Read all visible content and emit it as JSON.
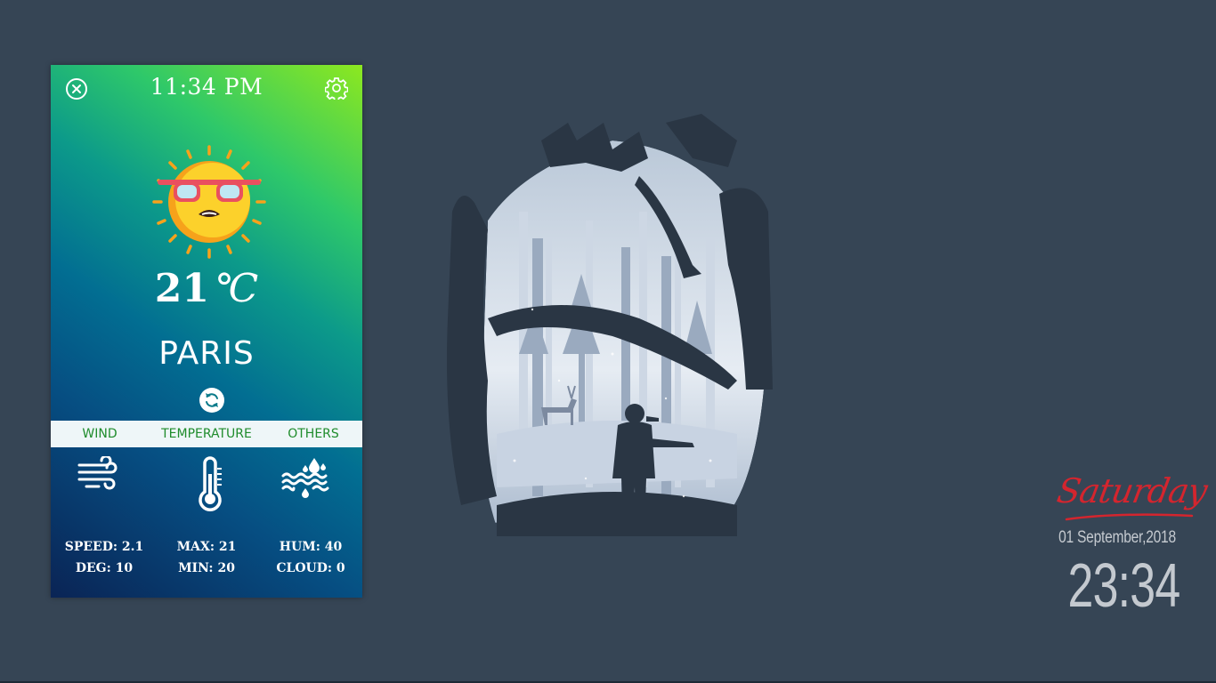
{
  "widget": {
    "time": "11:34 PM",
    "temperature": "21",
    "unit": "℃",
    "city": "PARIS",
    "tabs": [
      "WIND",
      "TEMPERATURE",
      "OTHERS"
    ],
    "stats": {
      "wind": {
        "line1": "SPEED: 2.1",
        "line2": "DEG: 10"
      },
      "temperature": {
        "line1": "MAX: 21",
        "line2": "MIN: 20"
      },
      "others": {
        "line1": "HUM: 40",
        "line2": "CLOUD: 0"
      }
    },
    "icons": [
      "close-icon",
      "settings-gear-icon",
      "sun-with-sunglasses-icon",
      "refresh-icon",
      "wind-icon",
      "thermometer-icon",
      "humidity-icon"
    ],
    "colors": {
      "gradient_top": "#8de81f",
      "gradient_bottom": "#0a2455",
      "tab_text": "#1f8c2c"
    }
  },
  "clock": {
    "day": "Saturday",
    "date": "01 September,2018",
    "time": "23:34",
    "colors": {
      "day": "#d4252e",
      "text": "#c4c9cf"
    }
  },
  "desktop": {
    "background": "#364555",
    "wallpaper_icon": "forest-hunter-silhouette-illustration"
  }
}
